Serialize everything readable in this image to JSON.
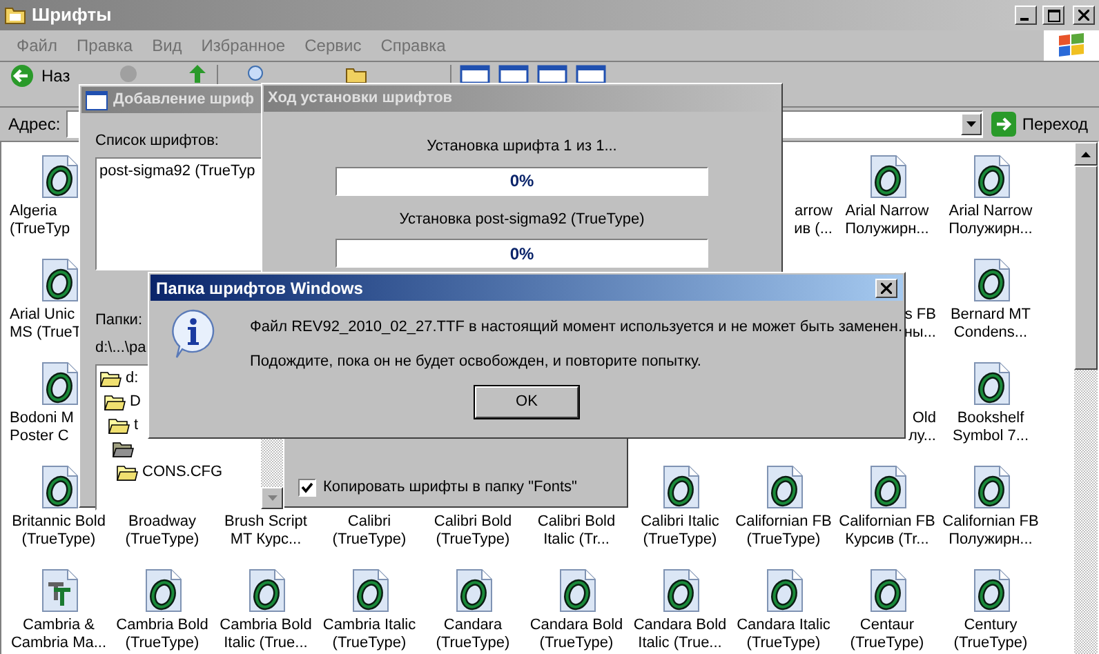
{
  "window": {
    "title": "Шрифты",
    "active": false
  },
  "menu": [
    "Файл",
    "Правка",
    "Вид",
    "Избранное",
    "Сервис",
    "Справка"
  ],
  "toolbar": {
    "back": "Наз"
  },
  "address": {
    "label": "Адрес:",
    "go": "Переход"
  },
  "icons": {
    "rows": [
      {
        "cells": [
          {
            "kind": "opentype",
            "lines": [
              "Algeria",
              "(TrueTyp"
            ]
          },
          null,
          null,
          null,
          null,
          null,
          null,
          {
            "lines": [
              "arrow",
              "ив (..."
            ]
          },
          {
            "kind": "opentype",
            "lines": [
              "Arial Narrow",
              "Полужирн..."
            ]
          },
          {
            "kind": "opentype",
            "lines": [
              "Arial Narrow",
              "Полужирн..."
            ]
          }
        ]
      },
      {
        "cells": [
          {
            "kind": "opentype",
            "lines": [
              "Arial Unic",
              "MS (TrueT"
            ]
          },
          null,
          null,
          null,
          null,
          null,
          null,
          null,
          {
            "lines": [
              "s FB",
              "ны..."
            ]
          },
          {
            "kind": "opentype",
            "lines": [
              "Bernard MT",
              "Condens..."
            ]
          }
        ]
      },
      {
        "cells": [
          {
            "kind": "opentype",
            "lines": [
              "Bodoni M",
              "Poster C"
            ]
          },
          null,
          null,
          null,
          null,
          null,
          null,
          null,
          {
            "lines": [
              "Old",
              "лу..."
            ]
          },
          {
            "kind": "opentype",
            "lines": [
              "Bookshelf",
              "Symbol 7..."
            ]
          }
        ]
      },
      {
        "cells": [
          {
            "kind": "opentype",
            "lines": [
              "Britannic Bold",
              "(TrueType)"
            ]
          },
          {
            "lines": [
              "Broadway",
              "(TrueType)"
            ]
          },
          {
            "lines": [
              "Brush Script",
              "MT Курс..."
            ]
          },
          {
            "lines": [
              "Calibri",
              "(TrueType)"
            ]
          },
          {
            "lines": [
              "Calibri Bold",
              "(TrueType)"
            ]
          },
          {
            "lines": [
              "Calibri Bold",
              "Italic (Tr..."
            ]
          },
          {
            "kind": "opentype",
            "lines": [
              "Calibri Italic",
              "(TrueType)"
            ]
          },
          {
            "kind": "opentype",
            "lines": [
              "Californian FB",
              "(TrueType)"
            ]
          },
          {
            "kind": "opentype",
            "lines": [
              "Californian FB",
              "Курсив (Tr..."
            ]
          },
          {
            "kind": "opentype",
            "lines": [
              "Californian FB",
              "Полужирн..."
            ]
          }
        ]
      },
      {
        "cells": [
          {
            "kind": "truetype",
            "lines": [
              "Cambria &",
              "Cambria Ma..."
            ]
          },
          {
            "kind": "opentype",
            "lines": [
              "Cambria Bold",
              "(TrueType)"
            ]
          },
          {
            "kind": "opentype",
            "lines": [
              "Cambria Bold",
              "Italic (True..."
            ]
          },
          {
            "kind": "opentype",
            "lines": [
              "Cambria Italic",
              "(TrueType)"
            ]
          },
          {
            "kind": "opentype",
            "lines": [
              "Candara",
              "(TrueType)"
            ]
          },
          {
            "kind": "opentype",
            "lines": [
              "Candara Bold",
              "(TrueType)"
            ]
          },
          {
            "kind": "opentype",
            "lines": [
              "Candara Bold",
              "Italic (True..."
            ]
          },
          {
            "kind": "opentype",
            "lines": [
              "Candara Italic",
              "(TrueType)"
            ]
          },
          {
            "kind": "opentype",
            "lines": [
              "Centaur",
              "(TrueType)"
            ]
          },
          {
            "kind": "opentype",
            "lines": [
              "Century",
              "(TrueType)"
            ]
          }
        ]
      }
    ]
  },
  "add_dialog": {
    "title": "Добавление шриф",
    "active": false,
    "list_label": "Список шрифтов:",
    "list_items": [
      "post-sigma92 (TrueTyp"
    ],
    "folders_label": "Папки:",
    "path": "d:\\...\\pa",
    "tree": [
      {
        "label": "d:",
        "children": [
          {
            "label": "D",
            "children": [
              {
                "label": "t",
                "children": [
                  {
                    "children": [
                      {
                        "label": "CONS.CFG"
                      }
                    ]
                  }
                ]
              }
            ]
          }
        ]
      }
    ],
    "copy_checkbox": {
      "label": "Копировать шрифты в папку \"Fonts\"",
      "checked": true
    }
  },
  "progress": {
    "title": "Ход установки шрифтов",
    "active": false,
    "items": [
      {
        "caption": "Установка шрифта 1 из 1...",
        "level": 0,
        "reading": "0%"
      },
      {
        "caption": "Установка post-sigma92 (TrueType)",
        "level": 0,
        "reading": "0%"
      }
    ]
  },
  "message": {
    "title": "Папка шрифтов Windows",
    "active": true,
    "lines": [
      "Файл REV92_2010_02_27.TTF в настоящий момент используется и не может быть заменен.",
      "Подождите, пока он не будет освобожден, и повторите попытку."
    ],
    "button": "OK"
  }
}
